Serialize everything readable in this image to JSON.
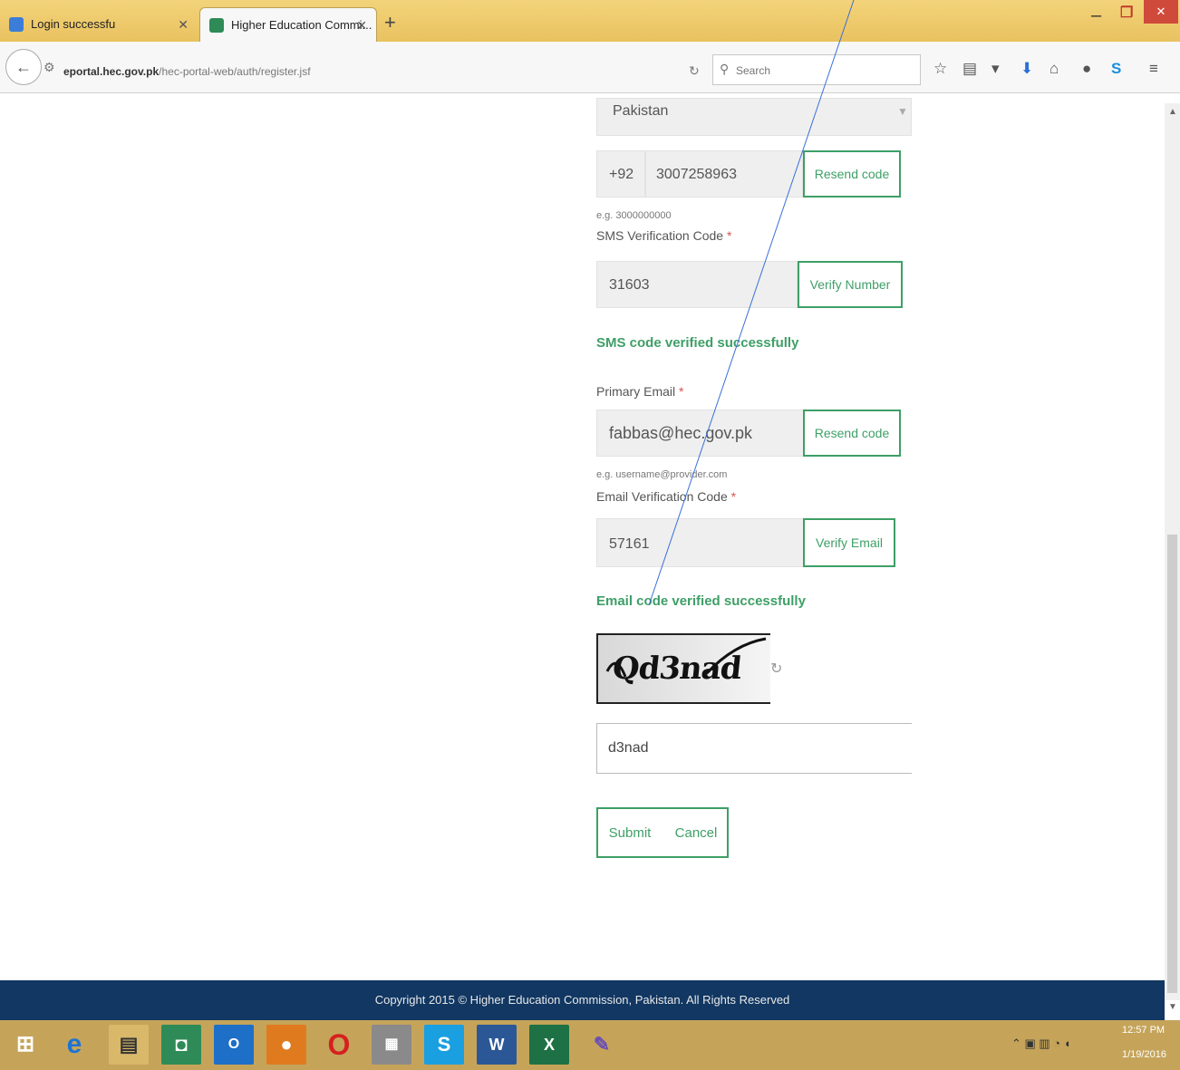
{
  "browser": {
    "tabs": [
      {
        "title": "Login successfu"
      },
      {
        "title": "Higher Education Commi..."
      }
    ],
    "url_domain": "eportal.hec.gov.pk",
    "url_path": "/hec-portal-web/auth/register.jsf",
    "search_placeholder": "Search"
  },
  "form": {
    "country": "Pakistan",
    "country_code": "+92",
    "phone": "3007258963",
    "phone_hint": "e.g. 3000000000",
    "resend_code_label": "Resend code",
    "sms_label": "SMS Verification Code",
    "sms_code": "31603",
    "verify_number_label": "Verify Number",
    "sms_success": "SMS code verified successfully",
    "email_label": "Primary Email",
    "email": "fabbas@hec.gov.pk",
    "email_hint": "e.g. username@provider.com",
    "email_code_label": "Email Verification Code",
    "email_code": "57161",
    "verify_email_label": "Verify Email",
    "email_success": "Email code verified successfully",
    "captcha_text": "Qd3nad",
    "captcha_value": "d3nad",
    "submit_label": "Submit",
    "cancel_label": "Cancel",
    "required_mark": "*"
  },
  "footer": {
    "text": "Copyright 2015 © Higher Education Commission, Pakistan. All Rights Reserved"
  },
  "taskbar": {
    "time": "12:57 PM",
    "date": "1/19/2016"
  },
  "colors": {
    "accent_green": "#3e9f67",
    "footer_navy": "#113762",
    "tabbar_gold": "#e9c260",
    "close_red": "#d04a3b"
  }
}
